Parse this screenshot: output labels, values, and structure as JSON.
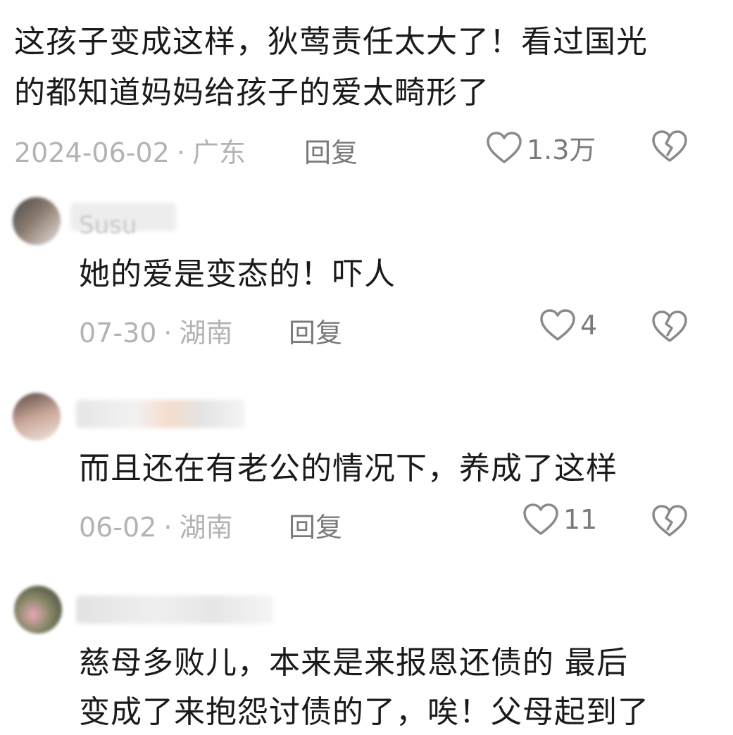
{
  "comments": [
    {
      "lines": [
        "这孩子变成这样，狄莺责任太大了！看过国光",
        "的都知道妈妈给孩子的爱太畸形了"
      ],
      "date": "2024-06-02",
      "location": "广东",
      "reply_label": "回复",
      "likes": "1.3万"
    },
    {
      "username": "Susu",
      "lines": [
        "她的爱是变态的！吓人"
      ],
      "date": "07-30",
      "location": "湖南",
      "reply_label": "回复",
      "likes": "4"
    },
    {
      "lines": [
        "而且还在有老公的情况下，养成了这样"
      ],
      "date": "06-02",
      "location": "湖南",
      "reply_label": "回复",
      "likes": "11"
    },
    {
      "lines": [
        "慈母多败儿，本来是来报恩还债的  最后",
        "变成了来抱怨讨债的了，唉！父母起到了"
      ]
    }
  ],
  "separator": "·",
  "icons": {
    "like": "heart-outline-icon",
    "dislike": "broken-heart-icon"
  },
  "colors": {
    "text": "#1a1a1a",
    "meta": "#b3b3b3",
    "action": "#7a7a7a",
    "icon": "#8a8a8a"
  }
}
